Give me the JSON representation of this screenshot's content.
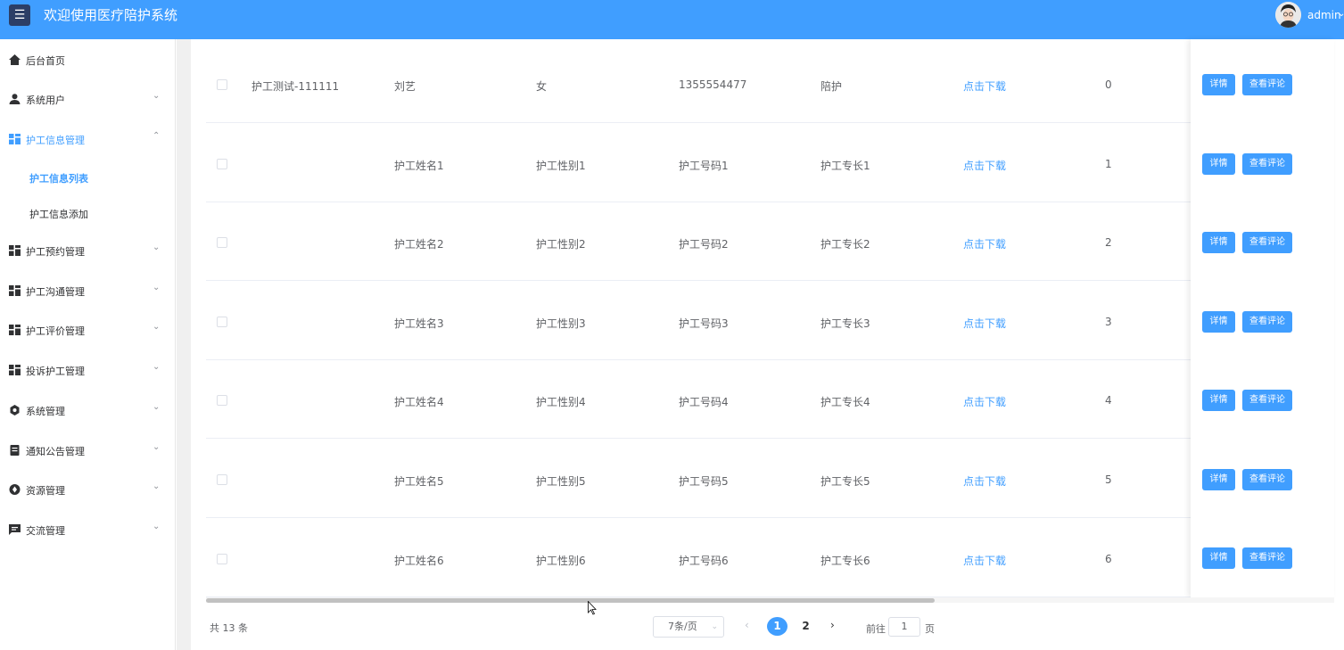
{
  "header": {
    "menu_icon": "menu-icon",
    "title": "欢迎使用医疗陪护系统",
    "user": "admin",
    "user_caret": "⌄"
  },
  "sidebar": {
    "items": [
      {
        "label": "后台首页",
        "icon": "home-icon",
        "caret": ""
      },
      {
        "label": "系统用户",
        "icon": "user-icon",
        "caret": "⌄"
      },
      {
        "label": "护工信息管理",
        "icon": "grid-icon",
        "caret": "⌃",
        "sub": [
          "护工信息列表",
          "护工信息添加"
        ]
      },
      {
        "label": "护工预约管理",
        "icon": "grid-icon",
        "caret": "⌄"
      },
      {
        "label": "护工沟通管理",
        "icon": "grid-icon",
        "caret": "⌄"
      },
      {
        "label": "护工评价管理",
        "icon": "grid-icon",
        "caret": "⌄"
      },
      {
        "label": "投诉护工管理",
        "icon": "grid-icon",
        "caret": "⌄"
      },
      {
        "label": "系统管理",
        "icon": "gear-icon",
        "caret": "⌄"
      },
      {
        "label": "通知公告管理",
        "icon": "document-icon",
        "caret": "⌄"
      },
      {
        "label": "资源管理",
        "icon": "resource-icon",
        "caret": "⌄"
      },
      {
        "label": "交流管理",
        "icon": "chat-icon",
        "caret": "⌄"
      }
    ]
  },
  "table": {
    "download_label": "点击下载",
    "detail_label": "详情",
    "review_label": "查看评论",
    "rows": [
      {
        "account": "护工测试-111111",
        "name": "刘艺",
        "gender": "女",
        "phone": "1355554477",
        "specialty": "陪护",
        "count": "0"
      },
      {
        "account": "",
        "name": "护工姓名1",
        "gender": "护工性别1",
        "phone": "护工号码1",
        "specialty": "护工专长1",
        "count": "1"
      },
      {
        "account": "",
        "name": "护工姓名2",
        "gender": "护工性别2",
        "phone": "护工号码2",
        "specialty": "护工专长2",
        "count": "2"
      },
      {
        "account": "",
        "name": "护工姓名3",
        "gender": "护工性别3",
        "phone": "护工号码3",
        "specialty": "护工专长3",
        "count": "3"
      },
      {
        "account": "",
        "name": "护工姓名4",
        "gender": "护工性别4",
        "phone": "护工号码4",
        "specialty": "护工专长4",
        "count": "4"
      },
      {
        "account": "",
        "name": "护工姓名5",
        "gender": "护工性别5",
        "phone": "护工号码5",
        "specialty": "护工专长5",
        "count": "5"
      },
      {
        "account": "",
        "name": "护工姓名6",
        "gender": "护工性别6",
        "phone": "护工号码6",
        "specialty": "护工专长6",
        "count": "6"
      }
    ]
  },
  "pagination": {
    "total": "共 13 条",
    "page_size": "7条/页",
    "pages": [
      "1",
      "2"
    ],
    "current_page": "1",
    "prev": "‹",
    "next": "›",
    "goto_label": "前往",
    "goto_value": "1",
    "goto_suffix": "页"
  },
  "colors": {
    "primary": "#409eff",
    "header_bg": "#409eff"
  }
}
